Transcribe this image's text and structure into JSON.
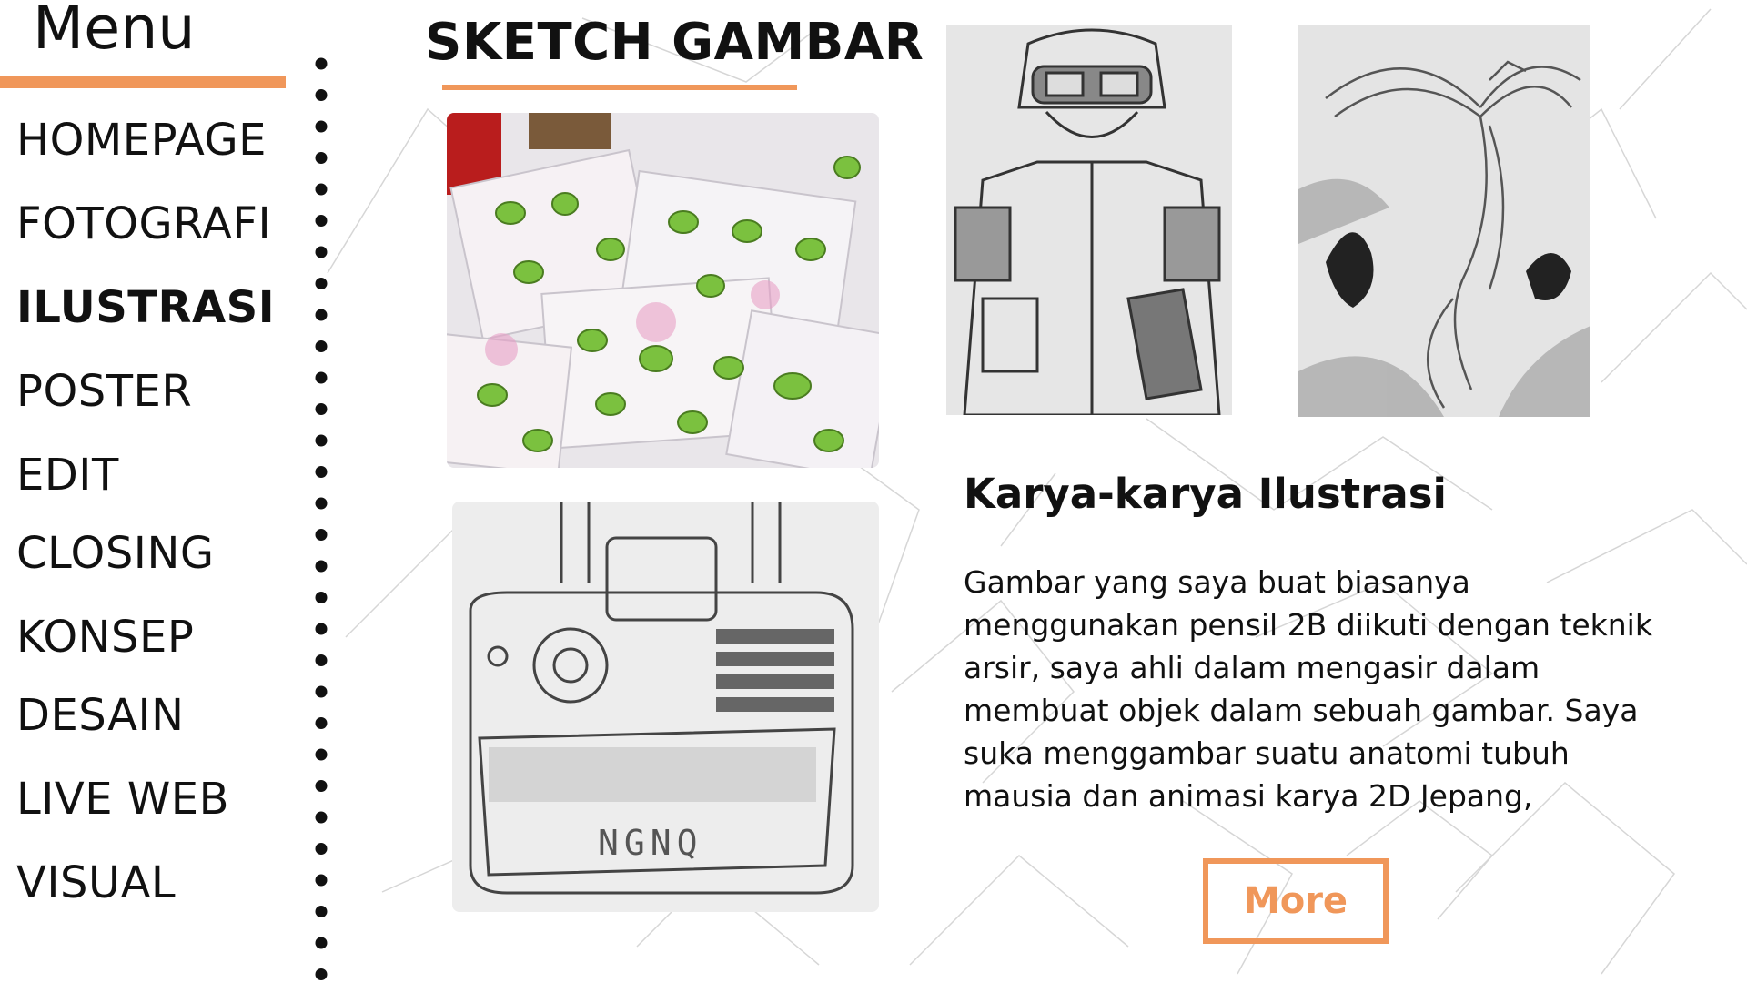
{
  "sidebar": {
    "title": "Menu",
    "items": [
      {
        "label": "HOMEPAGE",
        "active": false
      },
      {
        "label": "FOTOGRAFI",
        "active": false
      },
      {
        "label": "ILUSTRASI",
        "active": true
      },
      {
        "label": "POSTER",
        "active": false
      },
      {
        "label": "EDIT",
        "active": false
      },
      {
        "label": "CLOSING",
        "active": false
      },
      {
        "label": "KONSEP",
        "active": false
      },
      {
        "label": "DESAIN",
        "active": false
      },
      {
        "label": "LIVE WEB",
        "active": false
      },
      {
        "label": "VISUAL",
        "active": false
      }
    ]
  },
  "main": {
    "heading": "SKETCH GAMBAR",
    "images": [
      {
        "name": "colored-kiwi-sketches-photo"
      },
      {
        "name": "camera-pencil-sketch",
        "caption": "NGNQ"
      },
      {
        "name": "soldier-pencil-sketch"
      },
      {
        "name": "phoenix-pencil-sketch"
      }
    ],
    "card": {
      "title": "Karya-karya Ilustrasi",
      "body": "Gambar yang saya buat biasanya menggunakan pensil 2B diikuti dengan teknik arsir, saya ahli dalam mengasir dalam membuat objek dalam sebuah gambar. Saya suka menggambar suatu anatomi tubuh mausia dan animasi karya 2D Jepang,",
      "button_label": "More"
    }
  },
  "colors": {
    "accent": "#f0975a",
    "text": "#111111",
    "background": "#ffffff"
  }
}
